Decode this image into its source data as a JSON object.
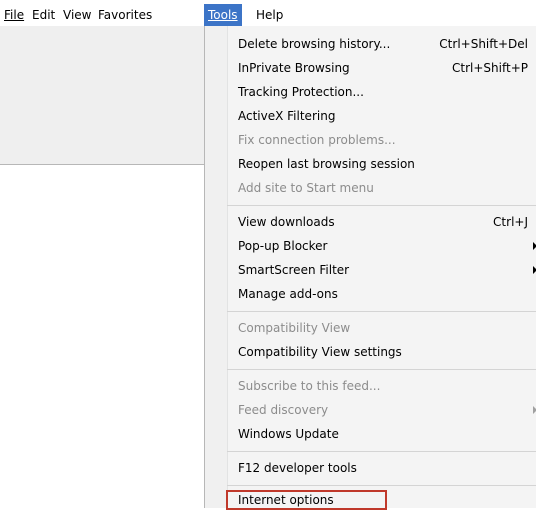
{
  "menubar": {
    "items": [
      {
        "id": "file",
        "label": "File"
      },
      {
        "id": "edit",
        "label": "Edit"
      },
      {
        "id": "view",
        "label": "View"
      },
      {
        "id": "favorites",
        "label": "Favorites"
      },
      {
        "id": "tools",
        "label": "Tools"
      },
      {
        "id": "help",
        "label": "Help"
      }
    ]
  },
  "tools_menu": {
    "items": [
      {
        "label": "Delete browsing history...",
        "shortcut": "Ctrl+Shift+Del"
      },
      {
        "label": "InPrivate Browsing",
        "shortcut": "Ctrl+Shift+P"
      },
      {
        "label": "Tracking Protection..."
      },
      {
        "label": "ActiveX Filtering"
      },
      {
        "label": "Fix connection problems..."
      },
      {
        "label": "Reopen last browsing session"
      },
      {
        "label": "Add site to Start menu"
      },
      {
        "label": "View downloads",
        "shortcut": "Ctrl+J"
      },
      {
        "label": "Pop-up Blocker"
      },
      {
        "label": "SmartScreen Filter"
      },
      {
        "label": "Manage add-ons"
      },
      {
        "label": "Compatibility View"
      },
      {
        "label": "Compatibility View settings"
      },
      {
        "label": "Subscribe to this feed..."
      },
      {
        "label": "Feed discovery"
      },
      {
        "label": "Windows Update"
      },
      {
        "label": "F12 developer tools"
      },
      {
        "label": "Internet options"
      }
    ]
  },
  "colors": {
    "active_menu_bg": "#3c74c7",
    "highlight_outline": "#c0392b",
    "disabled_text": "#8c8c8c"
  }
}
